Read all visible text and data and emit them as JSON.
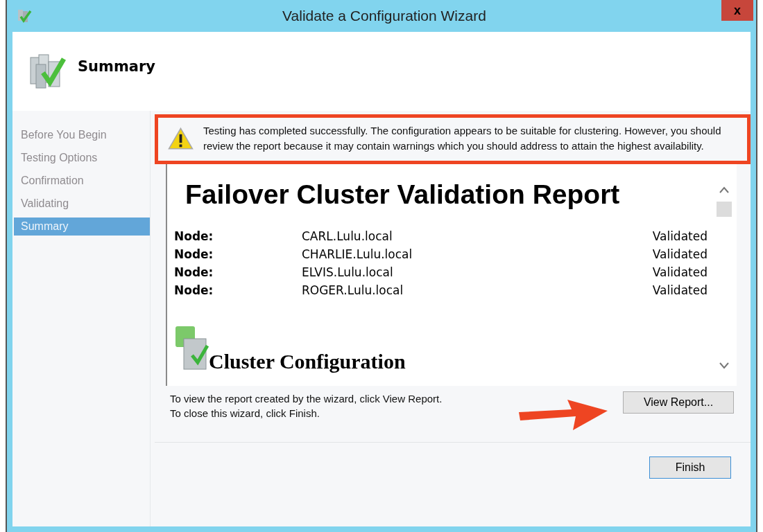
{
  "window": {
    "title": "Validate a Configuration Wizard",
    "close": "x"
  },
  "header": {
    "title": "Summary"
  },
  "steps": [
    {
      "label": "Before You Begin",
      "selected": false
    },
    {
      "label": "Testing Options",
      "selected": false
    },
    {
      "label": "Confirmation",
      "selected": false
    },
    {
      "label": "Validating",
      "selected": false
    },
    {
      "label": "Summary",
      "selected": true
    }
  ],
  "notice": {
    "text": "Testing has completed successfully. The configuration appears to be suitable for clustering. However, you should review the report because it may contain warnings which you should address to attain the highest availability."
  },
  "report": {
    "title": "Failover Cluster Validation Report",
    "nodes": [
      {
        "label": "Node:",
        "name": "CARL.Lulu.local",
        "status": "Validated"
      },
      {
        "label": "Node:",
        "name": "CHARLIE.Lulu.local",
        "status": "Validated"
      },
      {
        "label": "Node:",
        "name": "ELVIS.Lulu.local",
        "status": "Validated"
      },
      {
        "label": "Node:",
        "name": "ROGER.Lulu.local",
        "status": "Validated"
      }
    ],
    "section_title": "Cluster Configuration"
  },
  "instructions": [
    "To view the report created by the wizard, click View Report.",
    "To close this wizard, click Finish."
  ],
  "buttons": {
    "view_report": "View Report...",
    "finish": "Finish"
  }
}
